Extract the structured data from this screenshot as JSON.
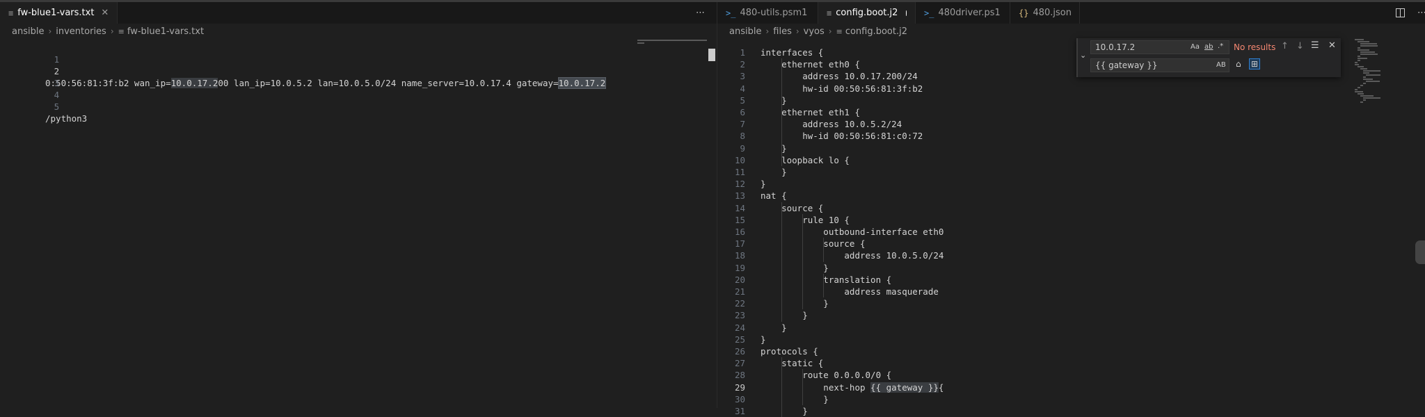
{
  "left": {
    "tab": {
      "label": "fw-blue1-vars.txt",
      "icon": "file-text-icon"
    },
    "breadcrumb": [
      "ansible",
      "inventories",
      "fw-blue1-vars.txt"
    ],
    "lines": [
      {
        "n": "1",
        "text": ""
      },
      {
        "n": "2",
        "pre": "0:50:56:81:3f:b2 wan_ip=",
        "h1": "10.0.17.2",
        "mid": "00 lan_ip=10.0.5.2 lan=10.0.5.0/24 name_server=10.0.17.4 gateway=",
        "h2": "10.0.17.2"
      },
      {
        "n": "3",
        "text": ""
      },
      {
        "n": "4",
        "text": ""
      },
      {
        "n": "5",
        "text": "/python3"
      }
    ]
  },
  "right": {
    "tabs": [
      {
        "label": "480-utils.psm1",
        "icon": "powershell-icon",
        "glyph": ">_"
      },
      {
        "label": "config.boot.j2",
        "icon": "file-text-icon",
        "glyph": "≡",
        "dirty": true
      },
      {
        "label": "480driver.ps1",
        "icon": "powershell-icon",
        "glyph": ">_"
      },
      {
        "label": "480.json",
        "icon": "json-icon",
        "glyph": "{}"
      }
    ],
    "breadcrumb": [
      "ansible",
      "files",
      "vyos",
      "config.boot.j2"
    ],
    "current_line": "29",
    "lines": [
      "interfaces {",
      "    ethernet eth0 {",
      "        address 10.0.17.200/24",
      "        hw-id 00:50:56:81:3f:b2",
      "    }",
      "    ethernet eth1 {",
      "        address 10.0.5.2/24",
      "        hw-id 00:50:56:81:c0:72",
      "    }",
      "    loopback lo {",
      "    }",
      "}",
      "nat {",
      "    source {",
      "        rule 10 {",
      "            outbound-interface eth0",
      "            source {",
      "                address 10.0.5.0/24",
      "            }",
      "            translation {",
      "                address masquerade",
      "            }",
      "        }",
      "    }",
      "}",
      "protocols {",
      "    static {",
      "        route 0.0.0.0/0 {",
      "            next-hop {{ gateway }}{",
      "            }",
      "        }"
    ]
  },
  "find": {
    "search_value": "10.0.17.2",
    "replace_value": "{{ gateway }}",
    "result": "No results",
    "opt_case": "Aa",
    "opt_word": "ab",
    "opt_regex": ".*",
    "opt_preserve_case": "AB"
  },
  "colors": {
    "no_results": "#f48771",
    "accent": "#2f7fd1"
  }
}
